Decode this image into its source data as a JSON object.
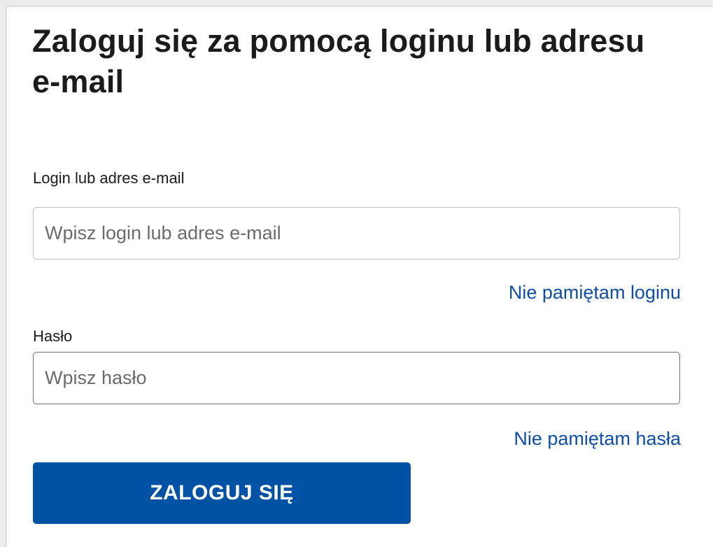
{
  "form": {
    "title": "Zaloguj się za pomocą loginu lub adresu e-mail",
    "login": {
      "label": "Login lub adres e-mail",
      "placeholder": "Wpisz login lub adres e-mail",
      "value": "",
      "forgot_link": "Nie pamiętam loginu"
    },
    "password": {
      "label": "Hasło",
      "placeholder": "Wpisz hasło",
      "value": "",
      "forgot_link": "Nie pamiętam hasła"
    },
    "submit_label": "ZALOGUJ SIĘ"
  },
  "colors": {
    "primary_button": "#0052a5",
    "link": "#0d4fa8",
    "text": "#1b1b1b"
  }
}
